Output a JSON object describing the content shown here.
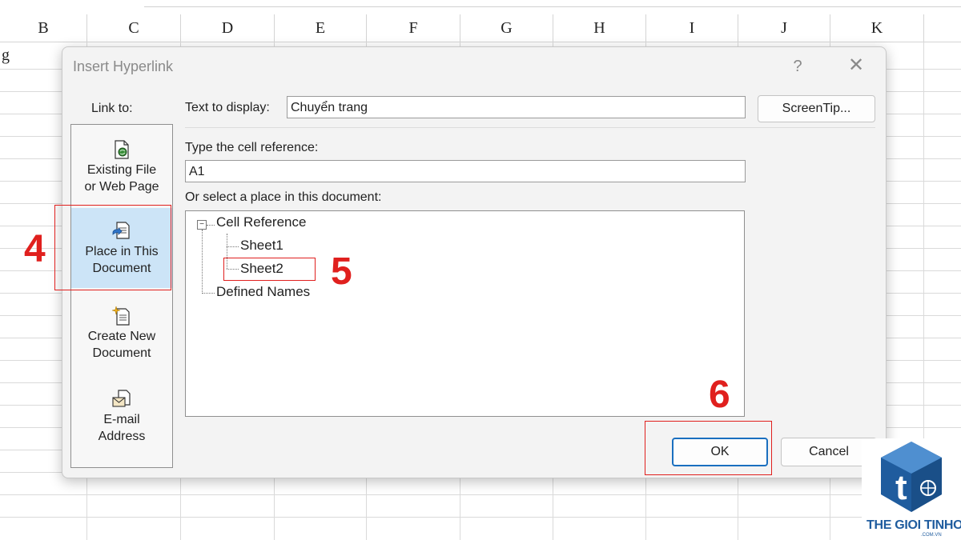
{
  "sheet": {
    "columns": [
      "B",
      "C",
      "D",
      "E",
      "F",
      "G",
      "H",
      "I",
      "J",
      "K"
    ],
    "partial_cell_text": "g"
  },
  "dialog": {
    "title": "Insert Hyperlink",
    "help": "?",
    "close": "✕",
    "link_to_label": "Link to:",
    "link_to_items": [
      {
        "line1": "Existing File",
        "line2": "or Web Page",
        "icon": "existing-file-icon"
      },
      {
        "line1": "Place in This",
        "line2": "Document",
        "icon": "place-in-document-icon",
        "selected": true
      },
      {
        "line1": "Create New",
        "line2": "Document",
        "icon": "create-new-document-icon"
      },
      {
        "line1": "E-mail",
        "line2": "Address",
        "icon": "email-address-icon"
      }
    ],
    "text_to_display_label": "Text to display:",
    "text_to_display_value": "Chuyển trang",
    "screentip_label": "ScreenTip...",
    "cell_reference_label": "Type the cell reference:",
    "cell_reference_value": "A1",
    "place_label": "Or select a place in this document:",
    "tree": {
      "root": "Cell Reference",
      "root_expander": "⊟",
      "children": [
        "Sheet1",
        "Sheet2"
      ],
      "defined_names": "Defined Names"
    },
    "ok_label": "OK",
    "cancel_label": "Cancel"
  },
  "annotations": {
    "step4": "4",
    "step5": "5",
    "step6": "6",
    "color": "#e0201e"
  },
  "logo": {
    "name": "THE GIOI TINHOC",
    "sub": ".COM.VN",
    "color": "#1f5c9e"
  }
}
